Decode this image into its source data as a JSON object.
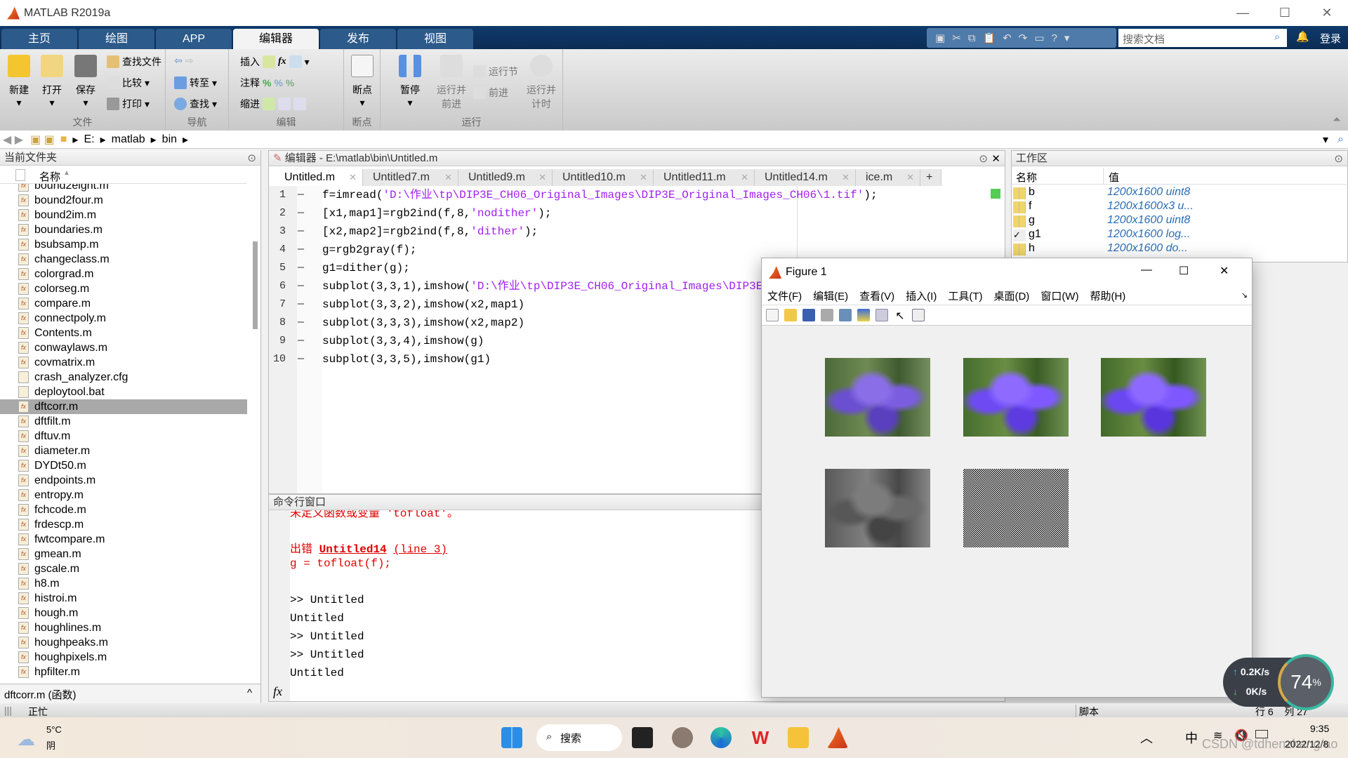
{
  "window": {
    "title": "MATLAB R2019a"
  },
  "ribbon_tabs": [
    "主页",
    "绘图",
    "APP",
    "编辑器",
    "发布",
    "视图"
  ],
  "quick_search_placeholder": "搜索文档",
  "login": "登录",
  "toolstrip": {
    "file": {
      "new": "新建",
      "open": "打开",
      "save": "保存",
      "find_files": "查找文件",
      "compare": "比较",
      "print": "打印",
      "label": "文件"
    },
    "nav": {
      "goto": "转至",
      "find": "查找",
      "label": "导航"
    },
    "edit": {
      "insert": "插入",
      "comment": "注释",
      "indent": "缩进",
      "fx": "fx",
      "label": "编辑"
    },
    "breakpoints": {
      "bp": "断点",
      "label": "断点"
    },
    "run": {
      "pause": "暂停",
      "run_advance": "运行并前进",
      "run_section": "运行节",
      "advance": "前进",
      "run_time": "运行并计时",
      "label": "运行"
    }
  },
  "address": {
    "path": [
      "E:",
      "matlab",
      "bin"
    ]
  },
  "current_folder": {
    "title": "当前文件夹",
    "col_name": "名称",
    "files": [
      "bound2eight.m",
      "bound2four.m",
      "bound2im.m",
      "boundaries.m",
      "bsubsamp.m",
      "changeclass.m",
      "colorgrad.m",
      "colorseg.m",
      "compare.m",
      "connectpoly.m",
      "Contents.m",
      "conwaylaws.m",
      "covmatrix.m",
      "crash_analyzer.cfg",
      "deploytool.bat",
      "dftcorr.m",
      "dftfilt.m",
      "dftuv.m",
      "diameter.m",
      "DYDt50.m",
      "endpoints.m",
      "entropy.m",
      "fchcode.m",
      "frdescp.m",
      "fwtcompare.m",
      "gmean.m",
      "gscale.m",
      "h8.m",
      "histroi.m",
      "hough.m",
      "houghlines.m",
      "houghpeaks.m",
      "houghpixels.m",
      "hpfilter.m"
    ],
    "selected": "dftcorr.m",
    "details": "dftcorr.m  (函数)"
  },
  "editor": {
    "title": "编辑器 - E:\\matlab\\bin\\Untitled.m",
    "tabs": [
      "Untitled.m",
      "Untitled7.m",
      "Untitled9.m",
      "Untitled10.m",
      "Untitled11.m",
      "Untitled14.m",
      "ice.m"
    ],
    "lines": [
      {
        "n": "1",
        "pre": "f=imread(",
        "str": "'D:\\作业\\tp\\DIP3E_CH06_Original_Images\\DIP3E_Original_Images_CH06\\1.tif'",
        "post": ");"
      },
      {
        "n": "2",
        "pre": "[x1,map1]=rgb2ind(f,8,",
        "str": "'nodither'",
        "post": ");"
      },
      {
        "n": "3",
        "pre": "[x2,map2]=rgb2ind(f,8,",
        "str": "'dither'",
        "post": ");"
      },
      {
        "n": "4",
        "pre": "g=rgb2gray(f);",
        "str": "",
        "post": ""
      },
      {
        "n": "5",
        "pre": "g1=dither(g);",
        "str": "",
        "post": ""
      },
      {
        "n": "6",
        "pre": "subplot(3,3,1),imshow(",
        "str": "'D:\\作业\\tp\\DIP3E_CH06_Original_Images\\DIP3E_Ori",
        "post": ""
      },
      {
        "n": "7",
        "pre": "subplot(3,3,2),imshow(x2,map1)",
        "str": "",
        "post": ""
      },
      {
        "n": "8",
        "pre": "subplot(3,3,3),imshow(x2,map2)",
        "str": "",
        "post": ""
      },
      {
        "n": "9",
        "pre": "subplot(3,3,4),imshow(g)",
        "str": "",
        "post": ""
      },
      {
        "n": "10",
        "pre": "subplot(3,3,5),imshow(g1)",
        "str": "",
        "post": ""
      }
    ]
  },
  "command_window": {
    "title": "命令行窗口",
    "err_partial": "未定义函数或变量 'tofloat'。",
    "err_label": "出错",
    "err_file": "Untitled14",
    "err_line": "(line 3)",
    "err_code": "g = tofloat(f);",
    "lines": [
      ">> Untitled",
      "Untitled",
      ">> Untitled",
      ">> Untitled",
      "Untitled"
    ],
    "fx": "fx"
  },
  "workspace": {
    "title": "工作区",
    "col_name": "名称",
    "col_value": "值",
    "vars": [
      {
        "name": "b",
        "value": "1200x1600 uint8"
      },
      {
        "name": "f",
        "value": "1200x1600x3 u..."
      },
      {
        "name": "g",
        "value": "1200x1600 uint8"
      },
      {
        "name": "g1",
        "value": "1200x1600 log..."
      },
      {
        "name": "h",
        "value": "1200x1600 do..."
      }
    ]
  },
  "figure": {
    "title": "Figure 1",
    "menu": [
      "文件(F)",
      "编辑(E)",
      "查看(V)",
      "插入(I)",
      "工具(T)",
      "桌面(D)",
      "窗口(W)",
      "帮助(H)"
    ]
  },
  "status": {
    "busy": "正忙",
    "type": "脚本",
    "row_label": "行",
    "row": "6",
    "col_label": "列",
    "col": "27"
  },
  "network": {
    "up": "0.2K/s",
    "down": "0K/s",
    "percent": "74",
    "unit": "%"
  },
  "taskbar": {
    "temp": "5°C",
    "weather": "阴",
    "search": "搜索",
    "time": "9:35",
    "date": "2022/12/8",
    "ime": "中"
  },
  "watermark": "CSDN @tdhenzhang/ao"
}
